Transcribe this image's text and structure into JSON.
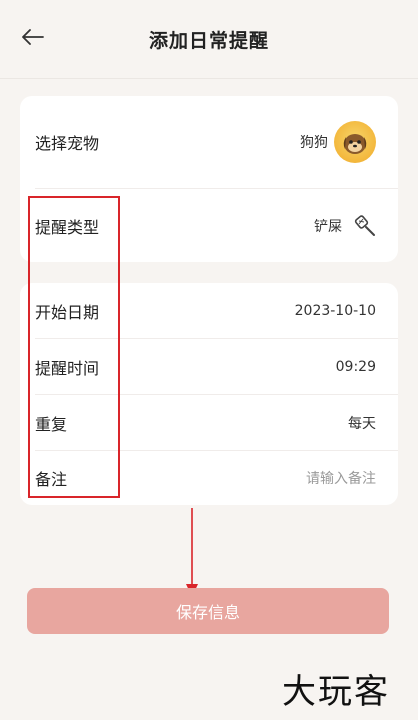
{
  "header": {
    "title": "添加日常提醒"
  },
  "pet_card": {
    "pet": {
      "label": "选择宠物",
      "value": "狗狗"
    },
    "type": {
      "label": "提醒类型",
      "value": "铲屎"
    }
  },
  "schedule_card": {
    "start_date": {
      "label": "开始日期",
      "value": "2023-10-10"
    },
    "time": {
      "label": "提醒时间",
      "value": "09:29"
    },
    "repeat": {
      "label": "重复",
      "value": "每天"
    },
    "note": {
      "label": "备注",
      "placeholder": "请输入备注"
    }
  },
  "save_button": {
    "label": "保存信息"
  },
  "watermark": {
    "text": "大玩客"
  },
  "colors": {
    "background": "#f7f4f1",
    "card": "#ffffff",
    "button": "#e8a69f",
    "annotation": "#d9252a"
  }
}
